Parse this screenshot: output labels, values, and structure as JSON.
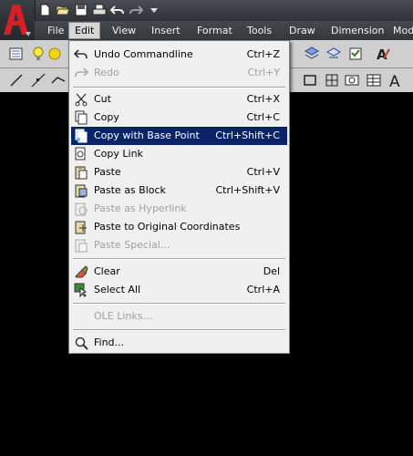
{
  "menubar": {
    "items": [
      "File",
      "Edit",
      "View",
      "Insert",
      "Format",
      "Tools",
      "Draw",
      "Dimension",
      "Mod"
    ],
    "active": "Edit"
  },
  "quick_access_icons": [
    "new-icon",
    "open-icon",
    "save-icon",
    "print-icon",
    "undo-icon",
    "redo-icon",
    "dropdown-arrow-icon"
  ],
  "edit_menu": {
    "items": [
      {
        "label": "Undo Commandline",
        "shortcut": "Ctrl+Z",
        "enabled": true,
        "icon": "undo-icon"
      },
      {
        "label": "Redo",
        "shortcut": "Ctrl+Y",
        "enabled": false,
        "icon": "redo-icon"
      },
      {
        "label": "Cut",
        "shortcut": "Ctrl+X",
        "enabled": true,
        "icon": "scissors-icon"
      },
      {
        "label": "Copy",
        "shortcut": "Ctrl+C",
        "enabled": true,
        "icon": "copy-icon"
      },
      {
        "label": "Copy with Base Point",
        "shortcut": "Ctrl+Shift+C",
        "enabled": true,
        "selected": true,
        "icon": "copy-base-point-icon"
      },
      {
        "label": "Copy Link",
        "shortcut": "",
        "enabled": true,
        "icon": "copy-link-icon"
      },
      {
        "label": "Paste",
        "shortcut": "Ctrl+V",
        "enabled": true,
        "icon": "paste-icon"
      },
      {
        "label": "Paste as Block",
        "shortcut": "Ctrl+Shift+V",
        "enabled": true,
        "icon": "paste-block-icon"
      },
      {
        "label": "Paste as Hyperlink",
        "shortcut": "",
        "enabled": false,
        "icon": "paste-hyperlink-icon"
      },
      {
        "label": "Paste to Original Coordinates",
        "shortcut": "",
        "enabled": true,
        "icon": "paste-coordinates-icon"
      },
      {
        "label": "Paste Special...",
        "shortcut": "",
        "enabled": false,
        "icon": "paste-special-icon"
      },
      {
        "label": "Clear",
        "shortcut": "Del",
        "enabled": true,
        "icon": "eraser-icon"
      },
      {
        "label": "Select All",
        "shortcut": "Ctrl+A",
        "enabled": true,
        "icon": "select-all-icon"
      },
      {
        "label": "OLE Links...",
        "shortcut": "",
        "enabled": false,
        "icon": ""
      },
      {
        "label": "Find...",
        "shortcut": "",
        "enabled": true,
        "icon": "find-icon"
      }
    ]
  },
  "colors": {
    "selection": "#0a246a",
    "menu_bg": "#f0f0f0",
    "logo_red": "#d81f26",
    "canvas": "#000000"
  }
}
